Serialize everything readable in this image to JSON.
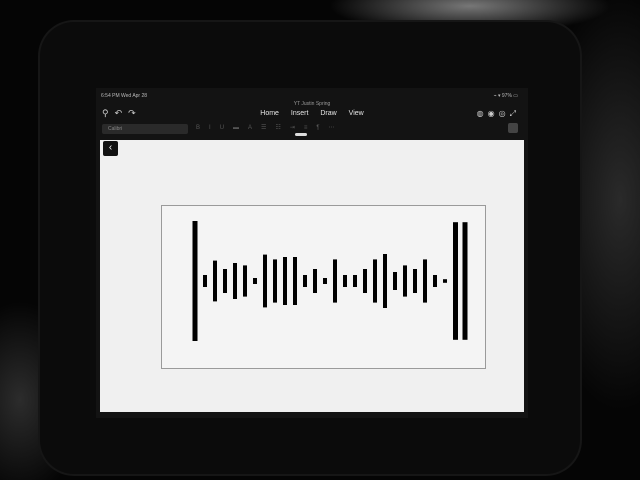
{
  "status": {
    "time_date": "6:54 PM   Wed Apr 28",
    "right_indicators": "⌁ ▾ 97% ▭"
  },
  "document": {
    "title": "YT Justin Spring"
  },
  "toolbar": {
    "left_icons": [
      "search-icon",
      "undo-icon",
      "redo-icon"
    ],
    "tabs": [
      "Home",
      "Insert",
      "Draw",
      "View"
    ],
    "right_icons": [
      "share-icon",
      "profile-icon",
      "layers-icon",
      "expand-icon"
    ]
  },
  "format_bar": {
    "font_placeholder": "Calibri"
  },
  "waveform": {
    "color": "#000000",
    "bar_heights": [
      1.0,
      0.1,
      0.34,
      0.2,
      0.3,
      0.26,
      0.05,
      0.44,
      0.36,
      0.4,
      0.4,
      0.1,
      0.2,
      0.05,
      0.36,
      0.1,
      0.1,
      0.2,
      0.36,
      0.45,
      0.15,
      0.26,
      0.2,
      0.36,
      0.1,
      0.03,
      0.98,
      0.98
    ]
  }
}
